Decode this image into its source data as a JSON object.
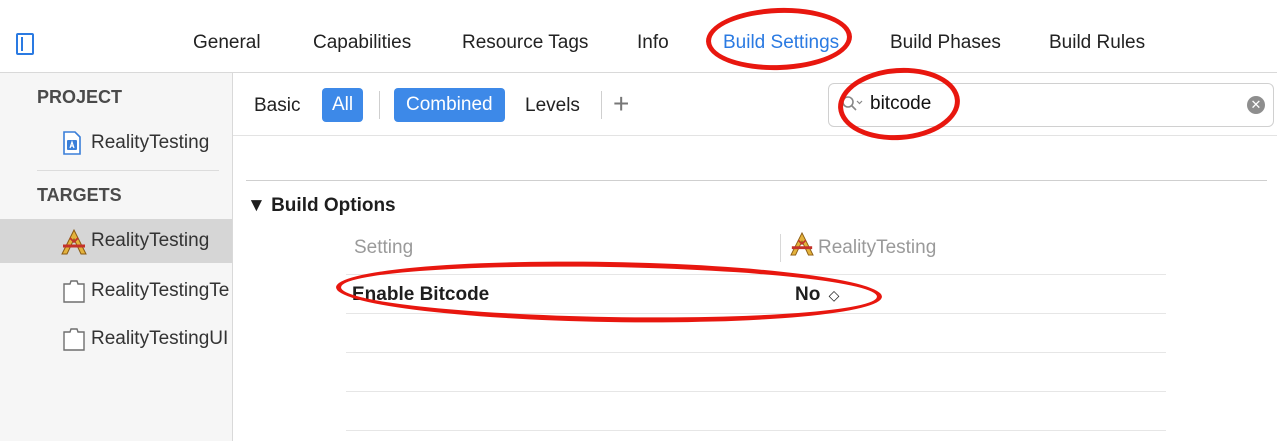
{
  "tabs": [
    {
      "label": "General",
      "active": false
    },
    {
      "label": "Capabilities",
      "active": false
    },
    {
      "label": "Resource Tags",
      "active": false
    },
    {
      "label": "Info",
      "active": false
    },
    {
      "label": "Build Settings",
      "active": true
    },
    {
      "label": "Build Phases",
      "active": false
    },
    {
      "label": "Build Rules",
      "active": false
    }
  ],
  "sidebar": {
    "project_header": "PROJECT",
    "project_items": [
      {
        "label": "RealityTesting",
        "icon": "project-file-icon"
      }
    ],
    "targets_header": "TARGETS",
    "target_items": [
      {
        "label": "RealityTesting",
        "icon": "app-target-icon",
        "selected": true
      },
      {
        "label": "RealityTestingTe...",
        "icon": "test-bundle-icon",
        "selected": false
      },
      {
        "label": "RealityTestingUI...",
        "icon": "test-bundle-icon",
        "selected": false
      }
    ]
  },
  "filter_bar": {
    "basic": "Basic",
    "all": "All",
    "combined": "Combined",
    "levels": "Levels",
    "add": "+"
  },
  "search": {
    "value": "bitcode",
    "placeholder": ""
  },
  "build_options": {
    "group_title": "▼ Build Options",
    "setting_header": "Setting",
    "target_header": "RealityTesting",
    "rows": [
      {
        "name": "Enable Bitcode",
        "value": "No",
        "stepper": "◇"
      }
    ]
  },
  "colors": {
    "accent": "#3d89e8",
    "annotation": "#e8170f"
  }
}
